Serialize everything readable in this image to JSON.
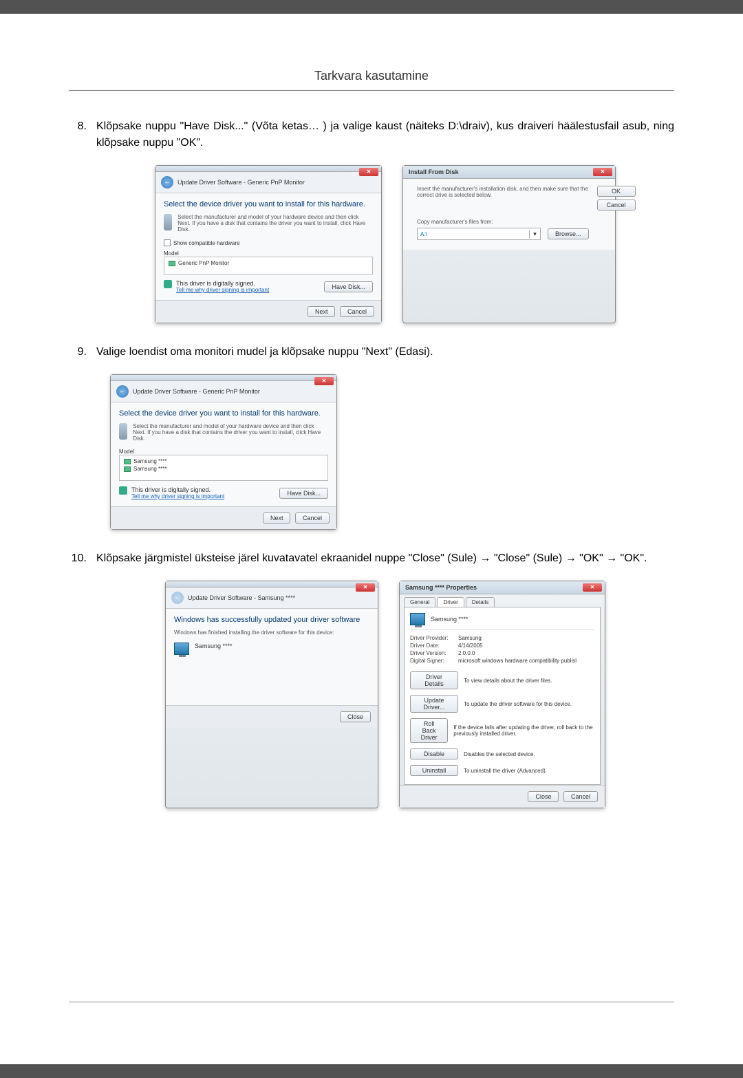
{
  "header": "Tarkvara kasutamine",
  "steps": {
    "s8": {
      "num": "8.",
      "text": "Klõpsake nuppu \"Have Disk...\" (Võta ketas… ) ja valige kaust (näiteks D:\\draiv), kus draiveri häälestusfail asub, ning klõpsake nuppu \"OK\"."
    },
    "s9": {
      "num": "9.",
      "text": "Valige loendist oma monitori mudel ja klõpsake nuppu \"Next\" (Edasi)."
    },
    "s10": {
      "num": "10.",
      "text": "Klõpsake järgmistel üksteise järel kuvatavatel ekraanidel nuppe \"Close\" (Sule) → \"Close\" (Sule) → \"OK\" → \"OK\"."
    }
  },
  "dlg1": {
    "nav": "Update Driver Software - Generic PnP Monitor",
    "head": "Select the device driver you want to install for this hardware.",
    "instr": "Select the manufacturer and model of your hardware device and then click Next. If you have a disk that contains the driver you want to install, click Have Disk.",
    "show_compat": "Show compatible hardware",
    "model_lbl": "Model",
    "model_item": "Generic PnP Monitor",
    "signed": "This driver is digitally signed.",
    "tell_why": "Tell me why driver signing is important",
    "have_disk": "Have Disk...",
    "next": "Next",
    "cancel": "Cancel"
  },
  "dlg2": {
    "title": "Install From Disk",
    "msg": "Insert the manufacturer's installation disk, and then make sure that the correct drive is selected below.",
    "ok": "OK",
    "cancel": "Cancel",
    "copy_lbl": "Copy manufacturer's files from:",
    "drive": "A:\\",
    "browse": "Browse..."
  },
  "dlg3": {
    "nav": "Update Driver Software - Generic PnP Monitor",
    "head": "Select the device driver you want to install for this hardware.",
    "instr": "Select the manufacturer and model of your hardware device and then click Next. If you have a disk that contains the driver you want to install, click Have Disk.",
    "model_lbl": "Model",
    "item1": "Samsung ****",
    "item2": "Samsung ****",
    "signed": "This driver is digitally signed.",
    "tell_why": "Tell me why driver signing is important",
    "have_disk": "Have Disk...",
    "next": "Next",
    "cancel": "Cancel"
  },
  "dlg4": {
    "nav": "Update Driver Software - Samsung ****",
    "head": "Windows has successfully updated your driver software",
    "sub": "Windows has finished installing the driver software for this device:",
    "device": "Samsung ****",
    "close": "Close"
  },
  "dlg5": {
    "title": "Samsung **** Properties",
    "tabs": {
      "general": "General",
      "driver": "Driver",
      "details": "Details"
    },
    "device": "Samsung ****",
    "provider_k": "Driver Provider:",
    "provider_v": "Samsung",
    "date_k": "Driver Date:",
    "date_v": "4/14/2005",
    "ver_k": "Driver Version:",
    "ver_v": "2.0.0.0",
    "signer_k": "Digital Signer:",
    "signer_v": "microsoft windows hardware compatibility publisl",
    "btn_details": "Driver Details",
    "txt_details": "To view details about the driver files.",
    "btn_update": "Update Driver...",
    "txt_update": "To update the driver software for this device.",
    "btn_roll": "Roll Back Driver",
    "txt_roll": "If the device fails after updating the driver, roll back to the previously installed driver.",
    "btn_disable": "Disable",
    "txt_disable": "Disables the selected device.",
    "btn_uninstall": "Uninstall",
    "txt_uninstall": "To uninstall the driver (Advanced).",
    "close": "Close",
    "cancel": "Cancel"
  }
}
